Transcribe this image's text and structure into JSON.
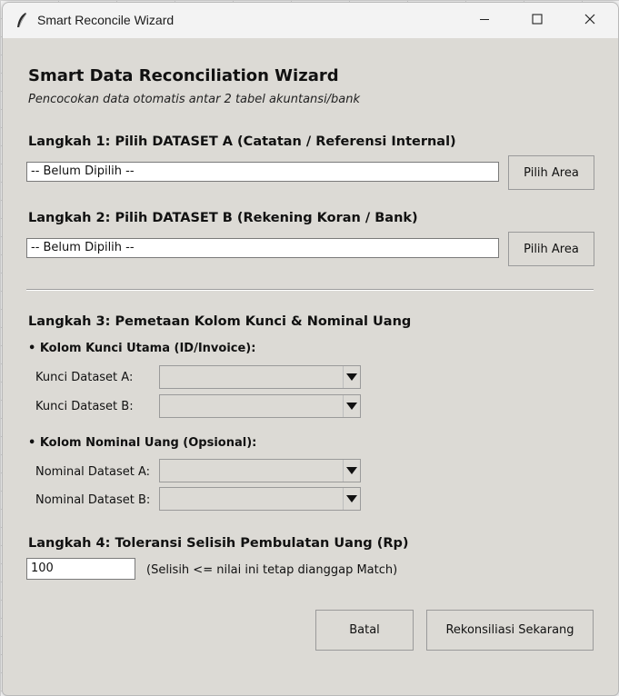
{
  "window": {
    "title": "Smart Reconcile Wizard",
    "controls": {
      "minimize": "minimize-icon",
      "maximize": "maximize-icon",
      "close": "close-icon"
    }
  },
  "header": {
    "title": "Smart Data Reconciliation Wizard",
    "subtitle": "Pencocokan data otomatis antar 2 tabel akuntansi/bank"
  },
  "step1": {
    "title": "Langkah 1: Pilih DATASET A (Catatan / Referensi Internal)",
    "value": "-- Belum Dipilih --",
    "button": "Pilih Area"
  },
  "step2": {
    "title": "Langkah 2: Pilih DATASET B (Rekening Koran / Bank)",
    "value": "-- Belum Dipilih --",
    "button": "Pilih Area"
  },
  "step3": {
    "title": "Langkah 3: Pemetaan Kolom Kunci & Nominal Uang",
    "key_section": "• Kolom Kunci Utama (ID/Invoice):",
    "key_a_label": "Kunci Dataset A:",
    "key_a_value": "",
    "key_b_label": "Kunci Dataset B:",
    "key_b_value": "",
    "amount_section": "• Kolom Nominal Uang (Opsional):",
    "amount_a_label": "Nominal Dataset A:",
    "amount_a_value": "",
    "amount_b_label": "Nominal Dataset B:",
    "amount_b_value": ""
  },
  "step4": {
    "title": "Langkah 4: Toleransi Selisih Pembulatan Uang (Rp)",
    "value": "100",
    "hint": "(Selisih <= nilai ini tetap dianggap Match)"
  },
  "actions": {
    "cancel": "Batal",
    "submit": "Rekonsiliasi Sekarang"
  }
}
